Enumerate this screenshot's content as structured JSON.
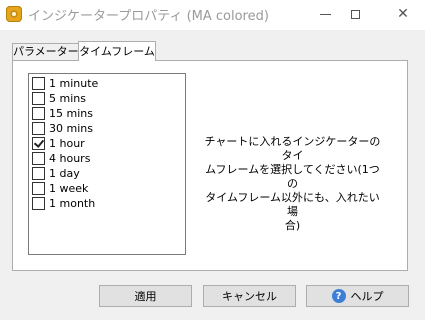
{
  "window": {
    "title": "インジケータープロパティ (MA colored)",
    "controls": {
      "close": "✕"
    }
  },
  "tabs": [
    {
      "label": "パラメーター",
      "active": false
    },
    {
      "label": "タイムフレーム",
      "active": true
    }
  ],
  "timeframes": [
    {
      "label": "1 minute",
      "checked": false
    },
    {
      "label": "5 mins",
      "checked": false
    },
    {
      "label": "15 mins",
      "checked": false
    },
    {
      "label": "30 mins",
      "checked": false
    },
    {
      "label": "1 hour",
      "checked": true
    },
    {
      "label": "4 hours",
      "checked": false
    },
    {
      "label": "1 day",
      "checked": false
    },
    {
      "label": "1 week",
      "checked": false
    },
    {
      "label": "1 month",
      "checked": false
    }
  ],
  "description": {
    "lines": [
      "チャートに入れるインジケーターのタイ",
      "ムフレームを選択してください(1つの",
      "タイムフレーム以外にも、入れたい場",
      "合)"
    ]
  },
  "buttons": {
    "apply": "適用",
    "cancel": "キャンセル",
    "help": "ヘルプ",
    "help_icon": "?"
  },
  "colors": {
    "app_icon": "#e7a61a",
    "help_icon": "#3d7fd6"
  }
}
